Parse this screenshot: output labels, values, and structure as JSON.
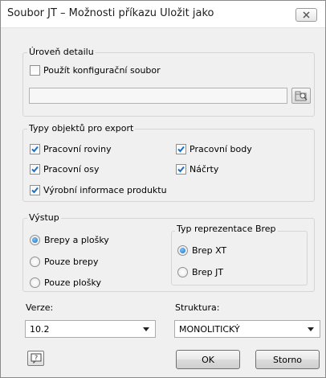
{
  "window": {
    "title": "Soubor JT – Možnosti příkazu Uložit jako"
  },
  "detail": {
    "group_label": "Úroveň detailu",
    "use_config_label": "Použít konfigurační soubor",
    "use_config_checked": false,
    "config_path_value": ""
  },
  "export_types": {
    "group_label": "Typy objektů pro export",
    "items": [
      {
        "label": "Pracovní roviny",
        "checked": true
      },
      {
        "label": "Pracovní body",
        "checked": true
      },
      {
        "label": "Pracovní osy",
        "checked": true
      },
      {
        "label": "Náčrty",
        "checked": true
      },
      {
        "label": "Výrobní informace produktu",
        "checked": true
      }
    ]
  },
  "output": {
    "group_label": "Výstup",
    "options": [
      {
        "label": "Brepy a plošky",
        "selected": true
      },
      {
        "label": "Pouze brepy",
        "selected": false
      },
      {
        "label": "Pouze plošky",
        "selected": false
      }
    ],
    "brep": {
      "group_label": "Typ reprezentace Brep",
      "options": [
        {
          "label": "Brep XT",
          "selected": true
        },
        {
          "label": "Brep JT",
          "selected": false
        }
      ]
    }
  },
  "version": {
    "label": "Verze:",
    "value": "10.2"
  },
  "structure": {
    "label": "Struktura:",
    "value": "MONOLITICKÝ"
  },
  "buttons": {
    "ok": "OK",
    "cancel": "Storno"
  },
  "colors": {
    "check_accent": "#1d6fc4",
    "window_bg": "#f0f0f0"
  }
}
